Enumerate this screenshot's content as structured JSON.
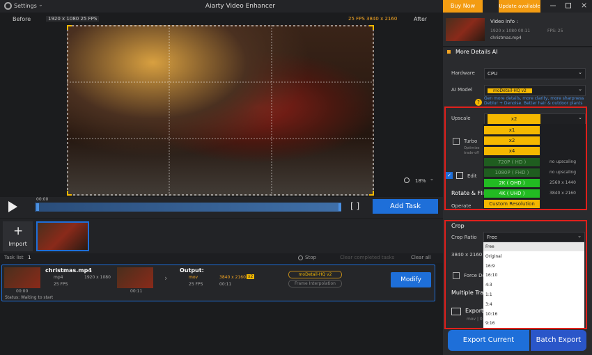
{
  "settings_label": "Settings",
  "app_title": "Aiarty Video Enhancer",
  "buy_now": "Buy Now",
  "update_available": "Update available",
  "preview": {
    "before": "Before",
    "after": "After",
    "source_info": "1920 x 1080  25 FPS",
    "output_info": "25 FPS  3840 x 2160",
    "zoom": "18%"
  },
  "player": {
    "time": "00:00",
    "add_task": "Add Task"
  },
  "import_label": "Import",
  "tasks": {
    "label": "Task list",
    "count": "1",
    "stop": "Stop",
    "clear_completed": "Clear completed tasks",
    "clear_all": "Clear all",
    "file_name": "christmas.mp4",
    "format": "mp4",
    "resolution": "1920 x 1080",
    "fps": "25 FPS",
    "time_src": "00:00",
    "output_label": "Output:",
    "out_format": "mov",
    "out_resolution": "3840 x 2160",
    "out_scale": "x2",
    "out_fps": "25 FPS",
    "out_time": "00:11",
    "thumb_time": "00:11",
    "model": "moDetail-HQ  v2",
    "frame_interp": "Frame Interpolation",
    "modify": "Modify",
    "status": "Status: Waiting to start"
  },
  "side": {
    "video_info": "Video Info :",
    "info_res": "1920 x 1080  00:11",
    "info_fps": "FPS: 25",
    "file_name": "christmas.mp4",
    "more_details": "More Details AI",
    "hardware_label": "Hardware",
    "hardware_value": "CPU",
    "ai_model_label": "AI Model",
    "ai_model_value": "moDetail-HQ  v2",
    "model_desc": "Gen more details, more clarity, more sharpness Deblur + Denoise. Better hair & outdoor plants",
    "upscale_label": "Upscale",
    "upscale_value": "x2",
    "turbo": "Turbo",
    "turbo_sub": "Optimize trade-off",
    "edit": "Edit",
    "rotate": "Rotate & Flip",
    "operate": "Operate",
    "upscale_options": [
      {
        "label": "x1",
        "note": ""
      },
      {
        "label": "x2",
        "note": ""
      },
      {
        "label": "x4",
        "note": ""
      },
      {
        "label": "720P ( HD )",
        "note": "no upscaling"
      },
      {
        "label": "1080P ( FHD )",
        "note": "no upscaling"
      },
      {
        "label": "2K ( QHD )",
        "note": "2560 x 1440"
      },
      {
        "label": "4K ( UHD )",
        "note": "3840 x 2160"
      },
      {
        "label": "Custom Resolution",
        "note": ""
      }
    ],
    "crop": "Crop",
    "crop_ratio_label": "Crop Ratio",
    "crop_ratio_value": "Free",
    "crop_res": "3840 x 2160",
    "force": "Force De",
    "multiple": "Multiple Trac",
    "export_label": "Export",
    "export_sub": "mov | 0",
    "crop_options": [
      "Free",
      "Original",
      "16:9",
      "16:10",
      "4:3",
      "1:1",
      "3:4",
      "10:16",
      "9:16"
    ],
    "export_current": "Export Current",
    "batch_export": "Batch Export"
  }
}
